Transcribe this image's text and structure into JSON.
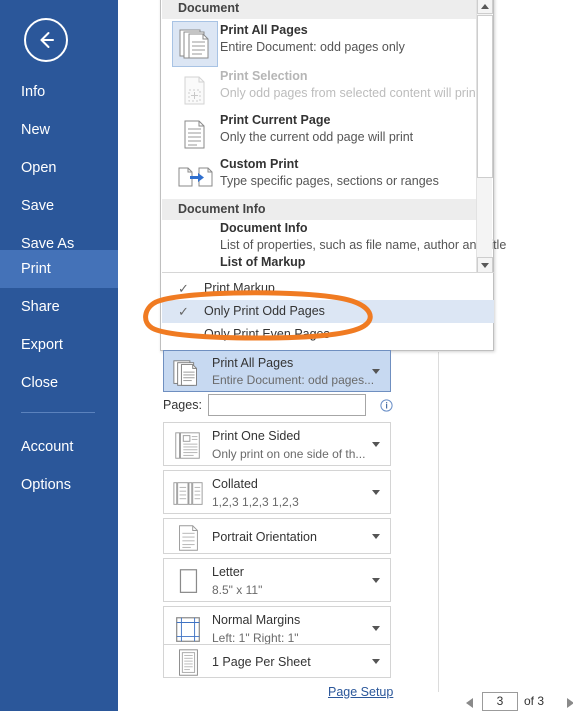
{
  "sidebar": {
    "back_icon": "back-arrow-icon",
    "items": [
      {
        "label": "Info",
        "active": false
      },
      {
        "label": "New",
        "active": false
      },
      {
        "label": "Open",
        "active": false
      },
      {
        "label": "Save",
        "active": false
      },
      {
        "label": "Save As",
        "active": false
      },
      {
        "label": "Print",
        "active": true
      },
      {
        "label": "Share",
        "active": false
      },
      {
        "label": "Export",
        "active": false
      },
      {
        "label": "Close",
        "active": false
      },
      {
        "label": "Account",
        "active": false
      },
      {
        "label": "Options",
        "active": false
      }
    ]
  },
  "dropdown": {
    "groups": [
      {
        "header": "Document"
      },
      {
        "header": "Document Info"
      }
    ],
    "document_items": [
      {
        "title": "Print All Pages",
        "subtitle": "Entire Document: odd pages only",
        "icon": "print-all-pages-icon",
        "selected": true,
        "disabled": false
      },
      {
        "title": "Print Selection",
        "subtitle": "Only odd pages from selected content will print",
        "icon": "print-selection-icon",
        "selected": false,
        "disabled": true
      },
      {
        "title": "Print Current Page",
        "subtitle": "Only the current odd page will print",
        "icon": "print-current-page-icon",
        "selected": false,
        "disabled": false
      },
      {
        "title": "Custom Print",
        "subtitle": "Type specific pages, sections or ranges",
        "icon": "custom-print-icon",
        "selected": false,
        "disabled": false
      }
    ],
    "document_info_items": [
      {
        "title": "Document Info",
        "subtitle": "List of properties, such as file name, author and title",
        "icon": "document-info-icon"
      },
      {
        "title": "List of Markup",
        "subtitle": "",
        "icon": "list-of-markup-icon"
      }
    ],
    "check_items": [
      {
        "label": "Print Markup",
        "checked": true,
        "highlighted": false
      },
      {
        "label": "Only Print Odd Pages",
        "checked": true,
        "highlighted": true
      },
      {
        "label": "Only Print Even Pages",
        "checked": false,
        "highlighted": false
      }
    ],
    "scrollbar": {
      "up_icon": "scroll-up-arrow-icon",
      "down_icon": "scroll-down-arrow-icon"
    }
  },
  "settings": {
    "range": {
      "title": "Print All Pages",
      "subtitle": "Entire Document: odd pages...",
      "icon": "print-all-pages-icon",
      "caret": "chevron-down-icon"
    },
    "pages": {
      "label": "Pages:",
      "value": "",
      "placeholder": "",
      "info_icon": "info-icon"
    },
    "sides": {
      "title": "Print One Sided",
      "subtitle": "Only print on one side of th...",
      "icon": "one-sided-icon"
    },
    "collation": {
      "title": "Collated",
      "subtitle": "1,2,3   1,2,3   1,2,3",
      "icon": "collated-icon"
    },
    "orientation": {
      "title": "Portrait Orientation",
      "subtitle": "",
      "icon": "portrait-icon"
    },
    "paper": {
      "title": "Letter",
      "subtitle": "8.5\" x 11\"",
      "icon": "paper-size-icon"
    },
    "margins": {
      "title": "Normal Margins",
      "subtitle": "Left:  1\"   Right:  1\"",
      "icon": "margins-icon"
    },
    "sheet": {
      "title": "1 Page Per Sheet",
      "subtitle": "",
      "icon": "pages-per-sheet-icon"
    },
    "page_setup_link": "Page Setup"
  },
  "page_nav": {
    "prev_icon": "prev-page-arrow-icon",
    "next_icon": "next-page-arrow-icon",
    "current_page": "3",
    "total_label": "of 3"
  },
  "annotation": {
    "shape": "orange-ellipse-highlight",
    "color": "#F07B22"
  },
  "colors": {
    "sidebar": "#2B579A",
    "sidebar_active": "#4472B8",
    "selection": "#DCE6F4",
    "settings_active": "#C7D9F1",
    "link": "#2B579A",
    "annotation": "#F07B22"
  }
}
